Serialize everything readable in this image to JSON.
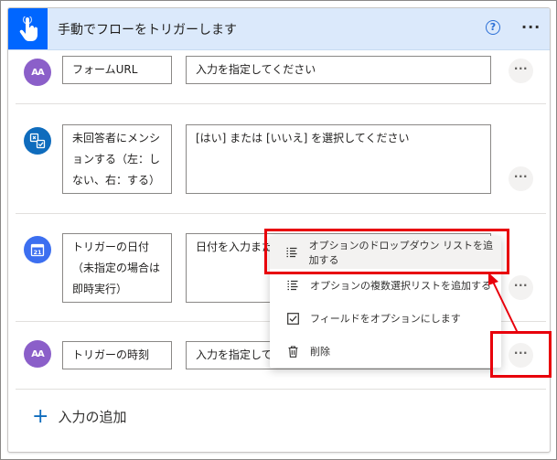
{
  "header": {
    "title": "手動でフローをトリガーします",
    "help_glyph": "?",
    "more_glyph": "···"
  },
  "rows": [
    {
      "label": "フォームURL",
      "value": "入力を指定してください",
      "icon": "text-icon",
      "icon_text": "AA"
    },
    {
      "label": "未回答者にメンションする（左：しない、右：する）",
      "value": "[はい] または [いいえ] を選択してください",
      "icon": "yes-no-icon"
    },
    {
      "label": "トリガーの日付（未指定の場合は即時実行）",
      "value": "日付を入力また",
      "icon": "calendar-icon",
      "icon_text": "21"
    },
    {
      "label": "トリガーの時刻",
      "value": "入力を指定して",
      "icon": "text-icon",
      "icon_text": "AA"
    }
  ],
  "row_more_glyph": "···",
  "context_menu": {
    "items": [
      {
        "label": "オプションのドロップダウン リストを追加する",
        "icon": "dropdown-list-icon"
      },
      {
        "label": "オプションの複数選択リストを追加する",
        "icon": "multi-select-list-icon"
      },
      {
        "label": "フィールドをオプションにします",
        "icon": "checkbox-icon"
      },
      {
        "label": "削除",
        "icon": "trash-icon"
      }
    ]
  },
  "add_input": {
    "plus": "+",
    "label": "入力の追加"
  },
  "colors": {
    "header_bg": "#dbe9fb",
    "trigger_icon_bg": "#0066ff",
    "text_icon_bg": "#8b5fc9",
    "yes_no_icon_bg": "#0f6cbd",
    "calendar_icon_bg": "#3c6ff0",
    "annotation_red": "#e8000b"
  }
}
